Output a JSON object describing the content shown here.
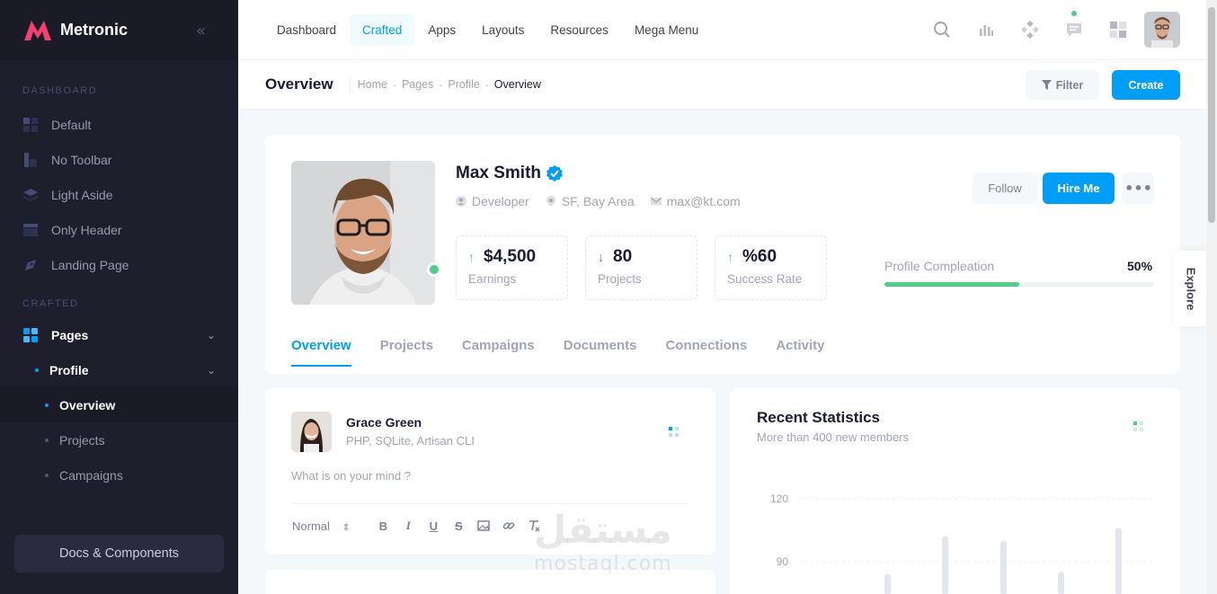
{
  "brand": {
    "name": "Metronic",
    "accent": "#f1416c"
  },
  "sidebar": {
    "section_dashboard": "Dashboard",
    "dashboard_items": [
      {
        "label": "Default",
        "icon": "grid-icon"
      },
      {
        "label": "No Toolbar",
        "icon": "layout-icon"
      },
      {
        "label": "Light Aside",
        "icon": "layers-icon"
      },
      {
        "label": "Only Header",
        "icon": "header-icon"
      },
      {
        "label": "Landing Page",
        "icon": "rocket-icon"
      }
    ],
    "section_crafted": "Crafted",
    "pages_label": "Pages",
    "profile_label": "Profile",
    "profile_children": [
      "Overview",
      "Projects",
      "Campaigns"
    ],
    "docs_button": "Docs & Components"
  },
  "header": {
    "menu": [
      "Dashboard",
      "Crafted",
      "Apps",
      "Layouts",
      "Resources",
      "Mega Menu"
    ],
    "active_menu": "Crafted"
  },
  "toolbar": {
    "title": "Overview",
    "breadcrumb": [
      "Home",
      "Pages",
      "Profile",
      "Overview"
    ],
    "filter_label": "Filter",
    "create_label": "Create"
  },
  "profile": {
    "name": "Max Smith",
    "role": "Developer",
    "location": "SF, Bay Area",
    "email": "max@kt.com",
    "stats": [
      {
        "value": "$4,500",
        "label": "Earnings",
        "trend": "up"
      },
      {
        "value": "80",
        "label": "Projects",
        "trend": "down"
      },
      {
        "value": "%60",
        "label": "Success Rate",
        "trend": "up"
      }
    ],
    "follow_label": "Follow",
    "hire_label": "Hire Me",
    "more_label": "•••",
    "completion_label": "Profile Compleation",
    "completion_value": "50%",
    "completion_fraction": 0.5,
    "tabs": [
      "Overview",
      "Projects",
      "Campaigns",
      "Documents",
      "Connections",
      "Activity"
    ],
    "active_tab": "Overview"
  },
  "explore_label": "Explore",
  "post": {
    "author": "Grace Green",
    "subtitle": "PHP, SQLite, Artisan CLI",
    "placeholder": "What is on your mind ?",
    "format_select": "Normal",
    "format_buttons": [
      "B",
      "I",
      "U",
      "S"
    ]
  },
  "stats_card": {
    "title": "Recent Statistics",
    "subtitle": "More than 400 new members"
  },
  "chart_data": {
    "type": "bar",
    "title": "Recent Statistics",
    "y_ticks": [
      "120",
      "90"
    ],
    "values": [
      84,
      102,
      100,
      85,
      106
    ],
    "ylim": [
      70,
      130
    ]
  },
  "watermark": {
    "arabic": "مستقل",
    "latin": "mostaql.com"
  }
}
